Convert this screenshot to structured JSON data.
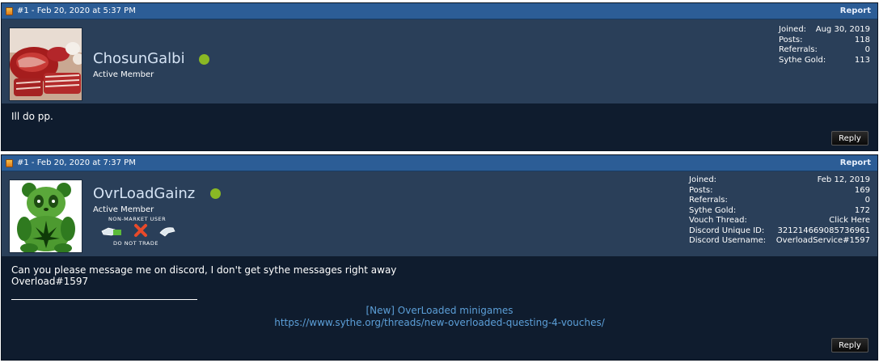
{
  "posts": [
    {
      "header": {
        "meta": "#1 - Feb 20, 2020 at 5:37 PM",
        "report": "Report"
      },
      "user": {
        "name": "ChosunGalbi",
        "rank": "Active Member",
        "online": true,
        "stats": [
          {
            "label": "Joined:",
            "value": "Aug 30, 2019"
          },
          {
            "label": "Posts:",
            "value": "118"
          },
          {
            "label": "Referrals:",
            "value": "0"
          },
          {
            "label": "Sythe Gold:",
            "value": "113"
          }
        ]
      },
      "body": {
        "text": "Ill do pp."
      },
      "reply": "Reply"
    },
    {
      "header": {
        "meta": "#1 - Feb 20, 2020 at 7:37 PM",
        "report": "Report"
      },
      "user": {
        "name": "OvrLoadGainz",
        "rank": "Active Member",
        "online": true,
        "badge": {
          "top": "NON-MARKET USER",
          "bottom": "DO NOT TRADE"
        },
        "stats": [
          {
            "label": "Joined:",
            "value": "Feb 12, 2019"
          },
          {
            "label": "Posts:",
            "value": "169"
          },
          {
            "label": "Referrals:",
            "value": "0"
          },
          {
            "label": "Sythe Gold:",
            "value": "172"
          },
          {
            "label": "Vouch Thread:",
            "value": "Click Here"
          },
          {
            "label": "Discord Unique ID:",
            "value": "321214669085736961"
          },
          {
            "label": "Discord Username:",
            "value": "OverloadService#1597"
          }
        ]
      },
      "body": {
        "line1": "Can you please message me on discord, I don't get sythe messages right away",
        "line2": "Overload#1597",
        "sig_link1": "[New] OverLoaded minigames",
        "sig_link2": "https://www.sythe.org/threads/new-overloaded-questing-4-vouches/"
      },
      "reply": "Reply"
    }
  ],
  "colors": {
    "header_bg": "#2c5d96",
    "userbar_bg": "#2a3f59",
    "body_bg": "#0f1c2e",
    "online": "#8ab824",
    "link": "#5c9fd8",
    "username": "#d5e3f4"
  },
  "icons": [
    "post-icon",
    "online-status-icon",
    "avatar",
    "trade-badge-icon"
  ]
}
